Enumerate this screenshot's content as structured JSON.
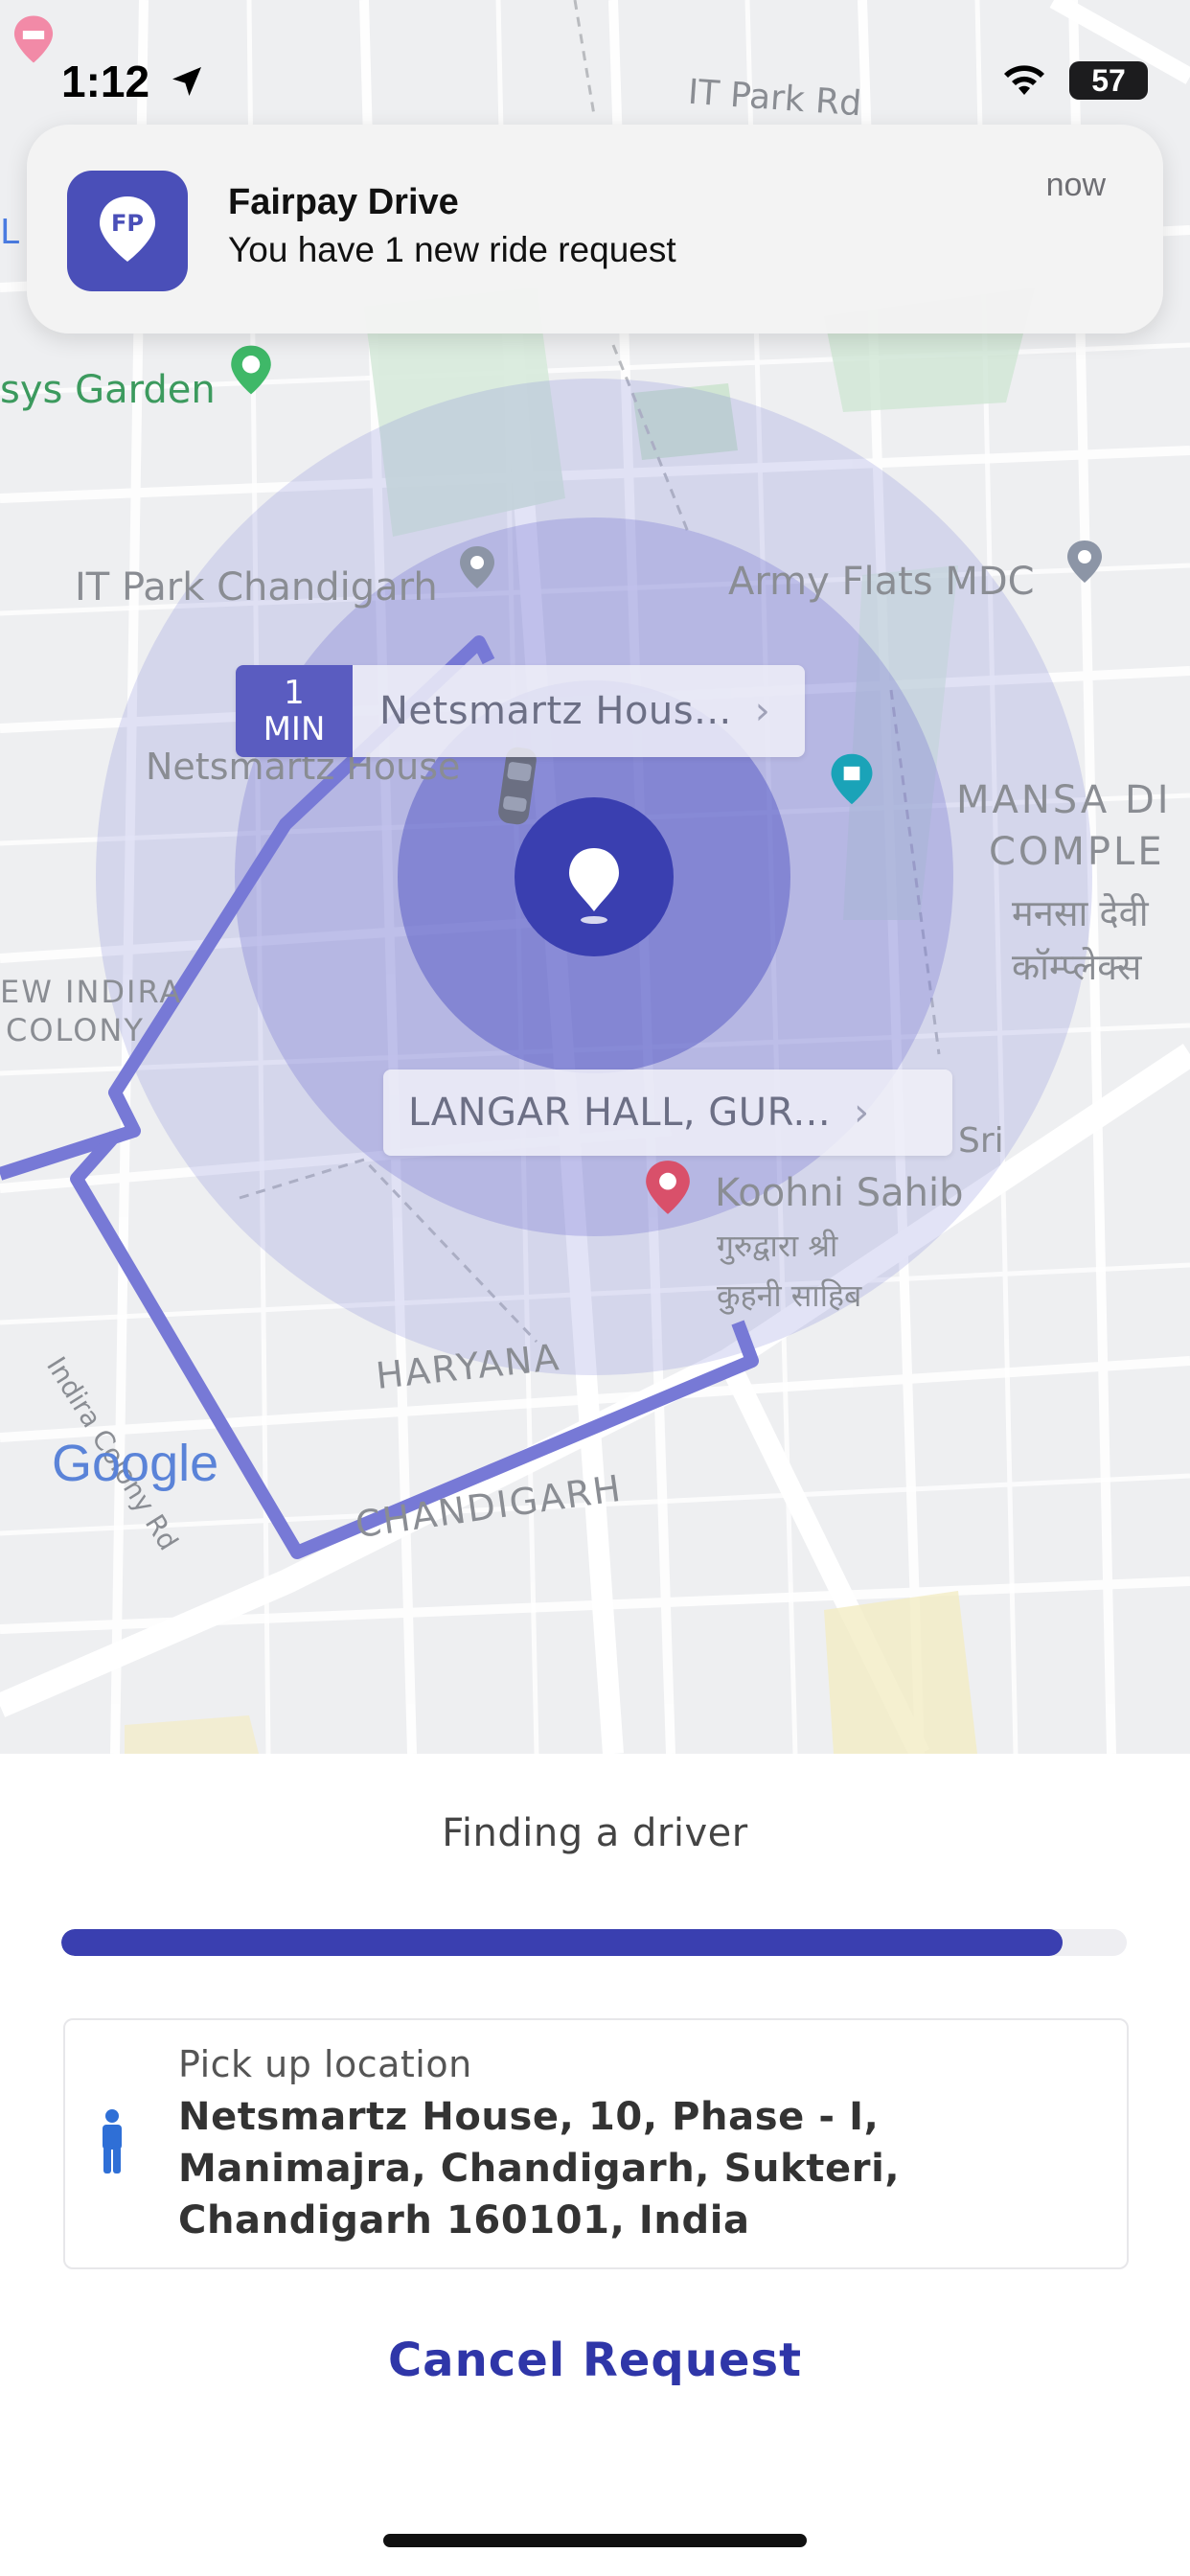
{
  "status_bar": {
    "time": "1:12",
    "battery": "57"
  },
  "notification": {
    "app_name": "Fairpay Drive",
    "message": "You have 1 new ride request",
    "time": "now",
    "icon_text": "FP"
  },
  "map": {
    "labels": {
      "it_park_rd": "IT Park Rd",
      "garden": "sys Garden",
      "it_park_chandigarh": "IT Park Chandigarh",
      "army_flats": "Army Flats MDC",
      "netsmartz_house": "Netsmartz House",
      "mansa_1": "MANSA DI",
      "mansa_2": "COMPLE",
      "mansa_hindi_1": "मनसा देवी",
      "mansa_hindi_2": "कॉम्प्लेक्स",
      "new_indira_1": "EW INDIRA",
      "new_indira_2": "COLONY",
      "koohni_sahib": "Koohni Sahib",
      "gurudwara_hindi_1": "गुरुद्वारा श्री",
      "gurudwara_hindi_2": "कुहनी साहिब",
      "sri": "Sri",
      "haryana": "HARYANA",
      "chandigarh": "CHANDIGARH",
      "indira_colony_rd": "Indira Colony Rd",
      "google": "Google",
      "left_edge_L": "L"
    },
    "route_chip_top": {
      "minutes": "1",
      "unit": "MIN",
      "destination": "Netsmartz Hous..."
    },
    "route_chip_bottom": {
      "destination": "LANGAR HALL, GUR..."
    }
  },
  "sheet": {
    "status_text": "Finding a driver",
    "progress": 0.94,
    "pickup_label": "Pick up location",
    "pickup_address": "Netsmartz House, 10, Phase - I, Manimajra, Chandigarh, Sukteri, Chandigarh 160101, India",
    "cancel_label": "Cancel Request"
  },
  "colors": {
    "brand": "#3a3fb0",
    "route": "#7779d6",
    "pulse": "#5b5fc7"
  },
  "icons": {
    "location_arrow": "location-arrow-icon",
    "wifi": "wifi-icon",
    "person": "person-icon",
    "pin": "map-pin-icon"
  }
}
